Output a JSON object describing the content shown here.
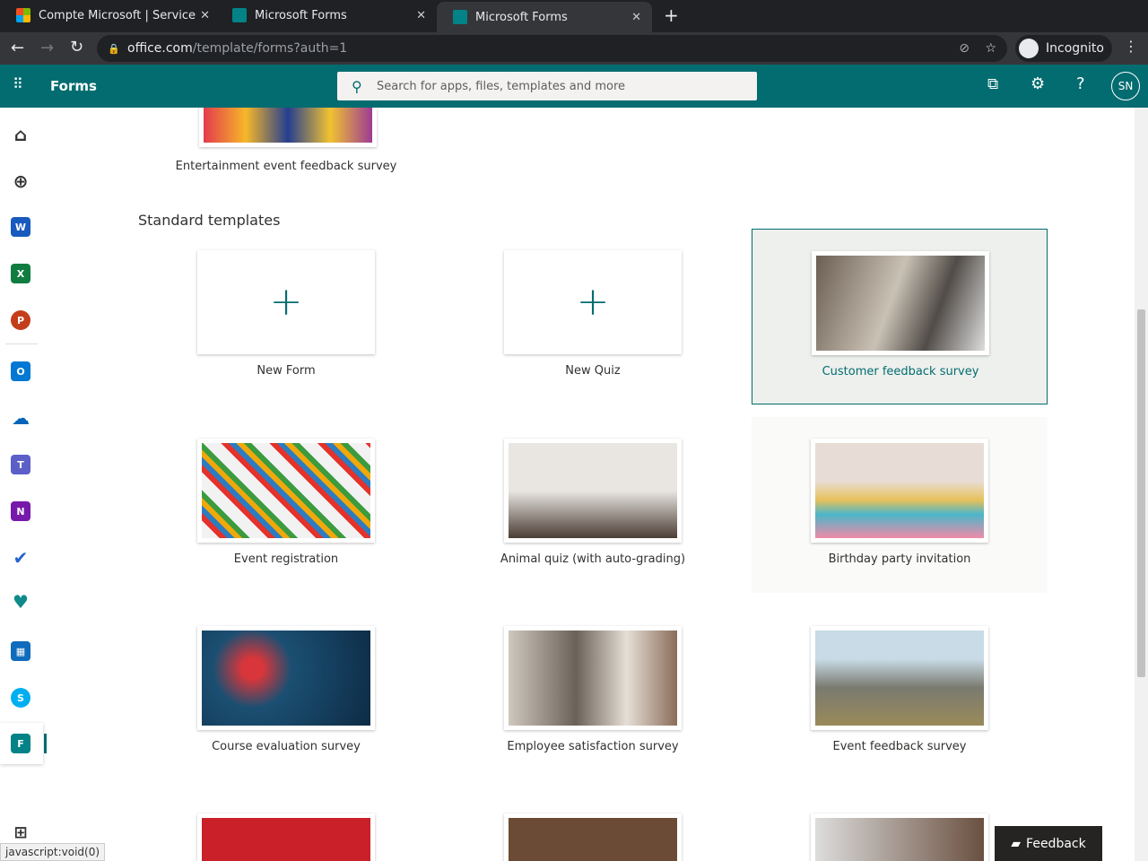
{
  "browser": {
    "tabs": [
      {
        "title": "Compte Microsoft | Service"
      },
      {
        "title": "Microsoft Forms"
      },
      {
        "title": "Microsoft Forms"
      }
    ],
    "url_domain": "office.com",
    "url_path": "/template/forms?auth=1",
    "profile": "Incognito"
  },
  "app": {
    "name": "Forms",
    "search_placeholder": "Search for apps, files, templates and more",
    "avatar": "SN"
  },
  "content": {
    "prev_item": "Entertainment event feedback survey",
    "section_title": "Standard templates",
    "templates": [
      {
        "label": "New Form",
        "type": "new"
      },
      {
        "label": "New Quiz",
        "type": "new"
      },
      {
        "label": "Customer feedback survey",
        "type": "image",
        "selected": true
      },
      {
        "label": "Event registration"
      },
      {
        "label": "Animal quiz (with auto-grading)"
      },
      {
        "label": "Birthday party invitation"
      },
      {
        "label": "Course evaluation survey"
      },
      {
        "label": "Employee satisfaction survey"
      },
      {
        "label": "Event feedback survey"
      }
    ]
  },
  "status_text": "javascript:void(0)",
  "feedback_label": "Feedback",
  "colors": {
    "brand": "#036c70"
  }
}
